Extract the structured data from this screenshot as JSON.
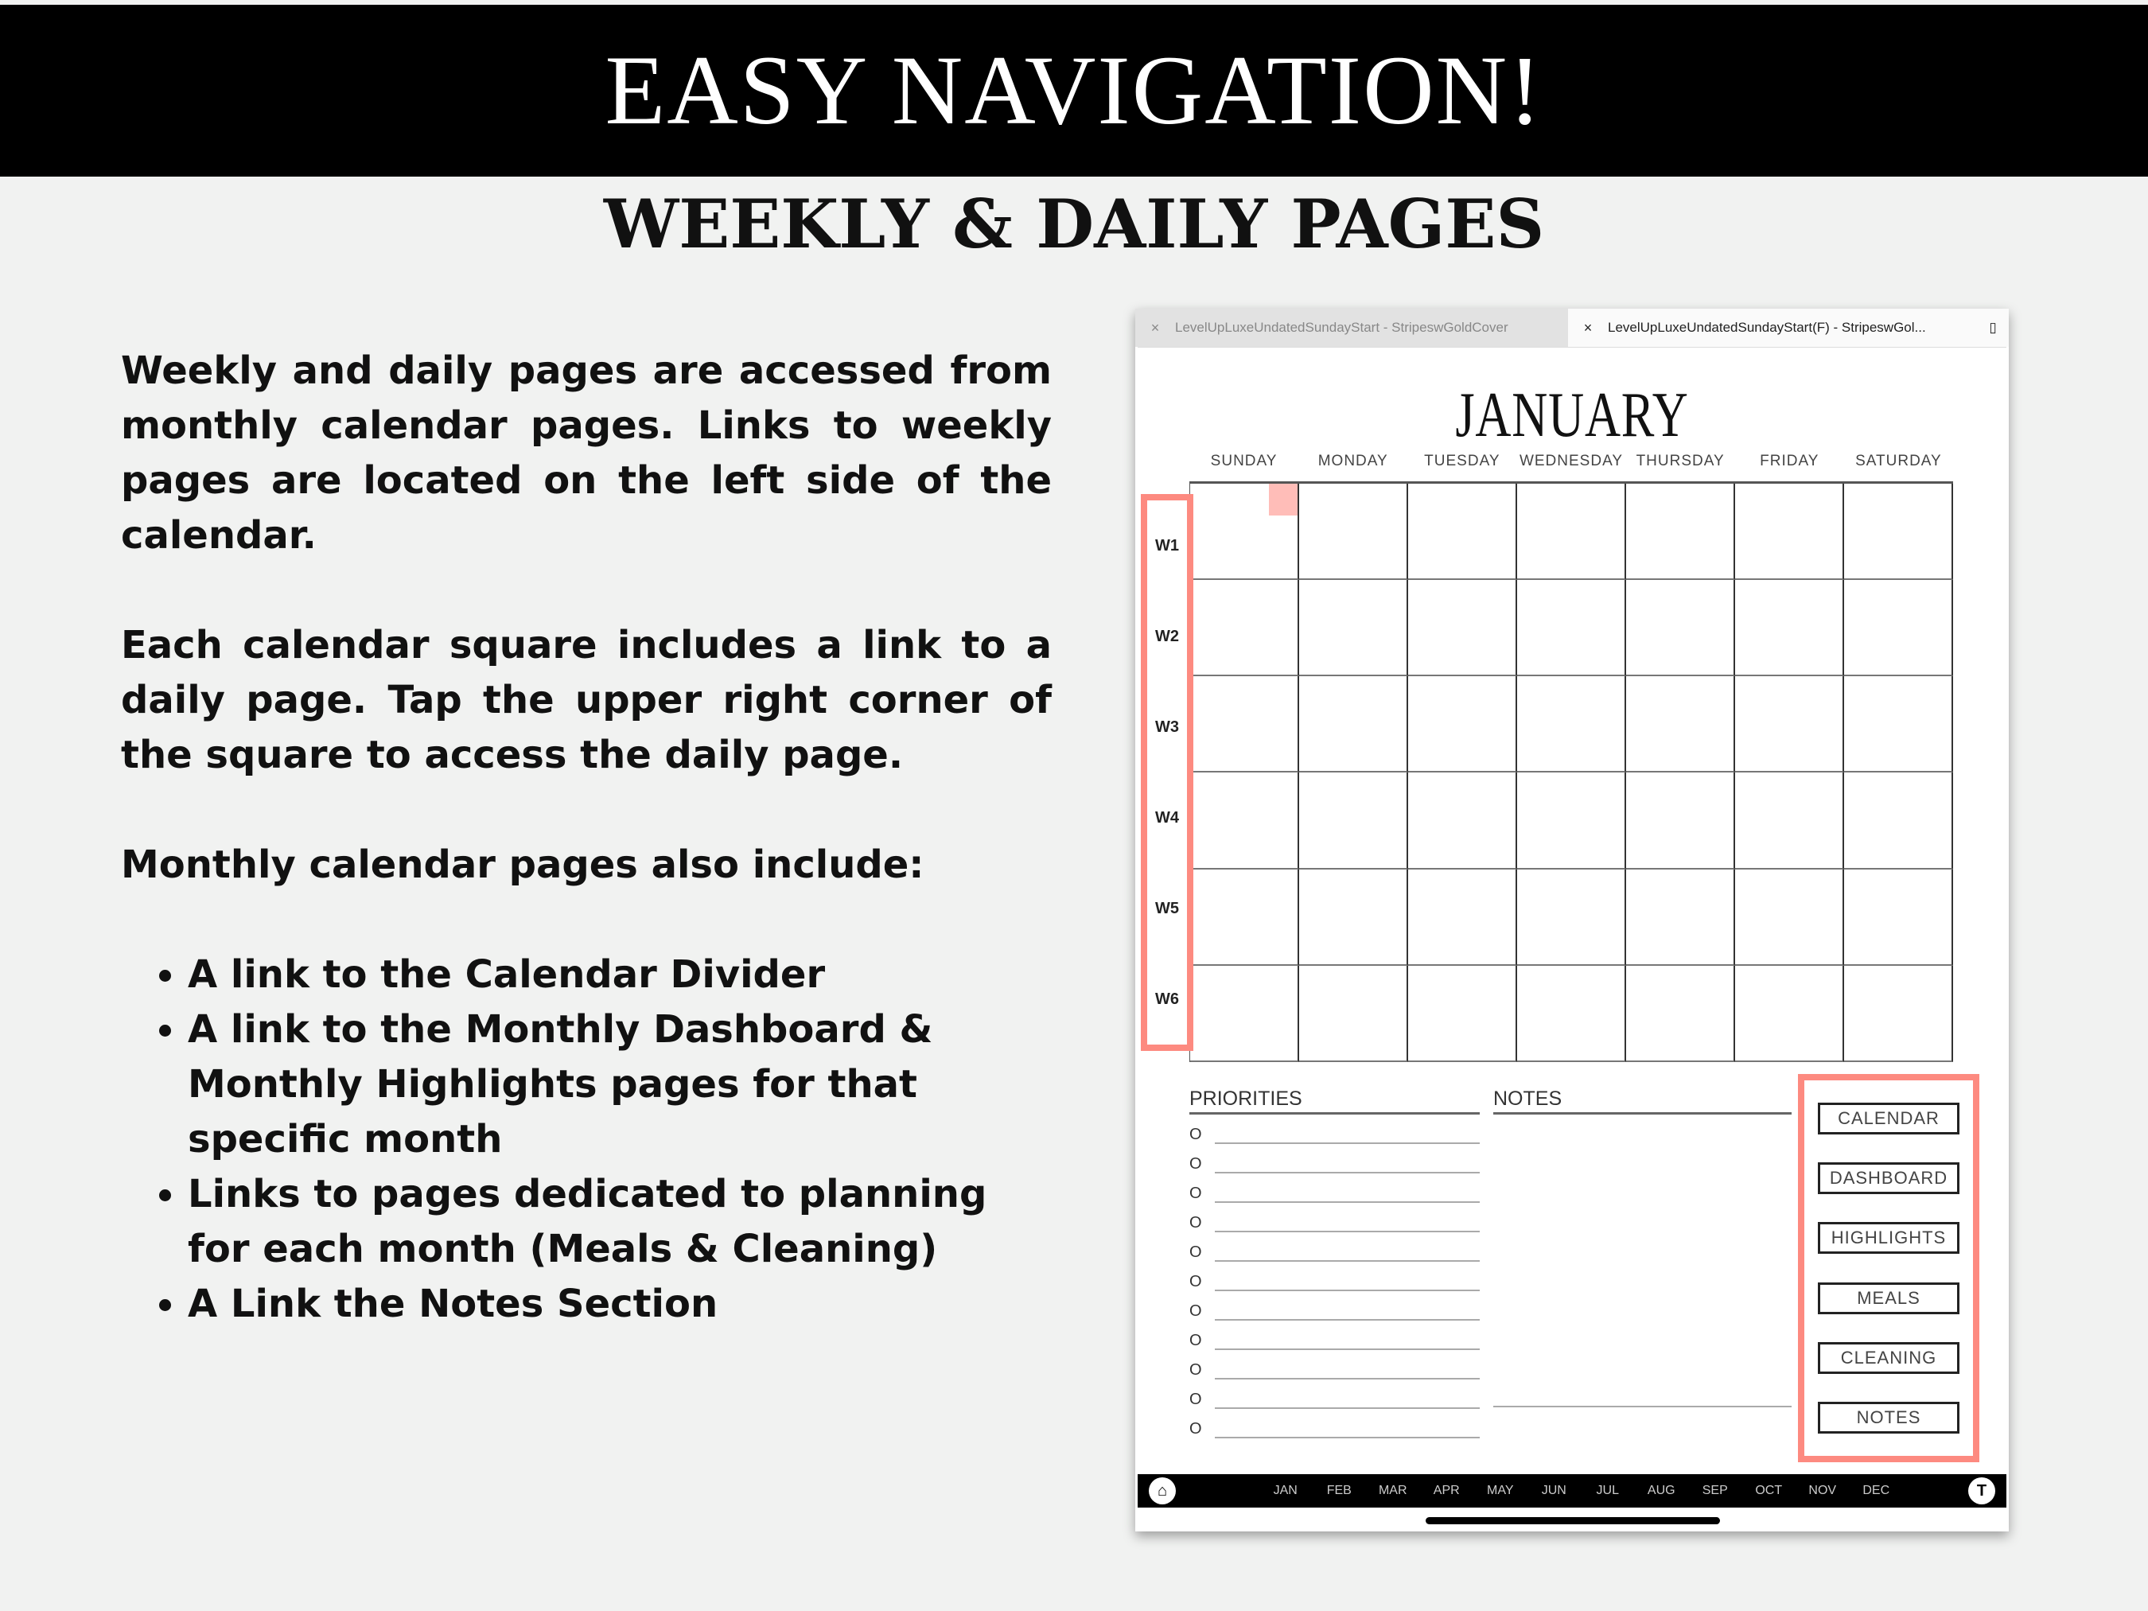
{
  "header": {
    "title": "EASY NAVIGATION!",
    "subtitle": "WEEKLY & DAILY PAGES"
  },
  "copy": {
    "p1": "Weekly and daily pages are accessed from monthly calendar pages. Links to weekly pages are located on the left side of the calendar.",
    "p2": "Each calendar square includes a link to a daily page. Tap the upper right corner of the square to access the daily page.",
    "p3": "Monthly calendar pages also include:",
    "bullets": [
      "A link to the Calendar Divider",
      "A link to the Monthly Dashboard & Monthly Highlights pages for that specific month",
      "Links to pages dedicated to planning for each month (Meals & Cleaning)",
      "A Link the Notes Section"
    ]
  },
  "screenshot": {
    "tabs": [
      {
        "label": "LevelUpLuxeUndatedSundayStart - StripeswGoldCover",
        "close": "×"
      },
      {
        "label": "LevelUpLuxeUndatedSundayStart(F) - StripeswGol...",
        "close": "×"
      }
    ],
    "month": "JANUARY",
    "days": [
      "SUNDAY",
      "MONDAY",
      "TUESDAY",
      "WEDNESDAY",
      "THURSDAY",
      "FRIDAY",
      "SATURDAY"
    ],
    "weeks": [
      "W1",
      "W2",
      "W3",
      "W4",
      "W5",
      "W6"
    ],
    "priorities_label": "PRIORITIES",
    "priority_marker": "O",
    "notes_label": "NOTES",
    "nav_buttons": [
      "CALENDAR",
      "DASHBOARD",
      "HIGHLIGHTS",
      "MEALS",
      "CLEANING",
      "NOTES"
    ],
    "months": [
      "JAN",
      "FEB",
      "MAR",
      "APR",
      "MAY",
      "JUN",
      "JUL",
      "AUG",
      "SEP",
      "OCT",
      "NOV",
      "DEC"
    ],
    "home_icon": "⌂",
    "t_icon": "T"
  },
  "colors": {
    "highlight": "#fd8a80",
    "corner": "#ffbdb8"
  }
}
